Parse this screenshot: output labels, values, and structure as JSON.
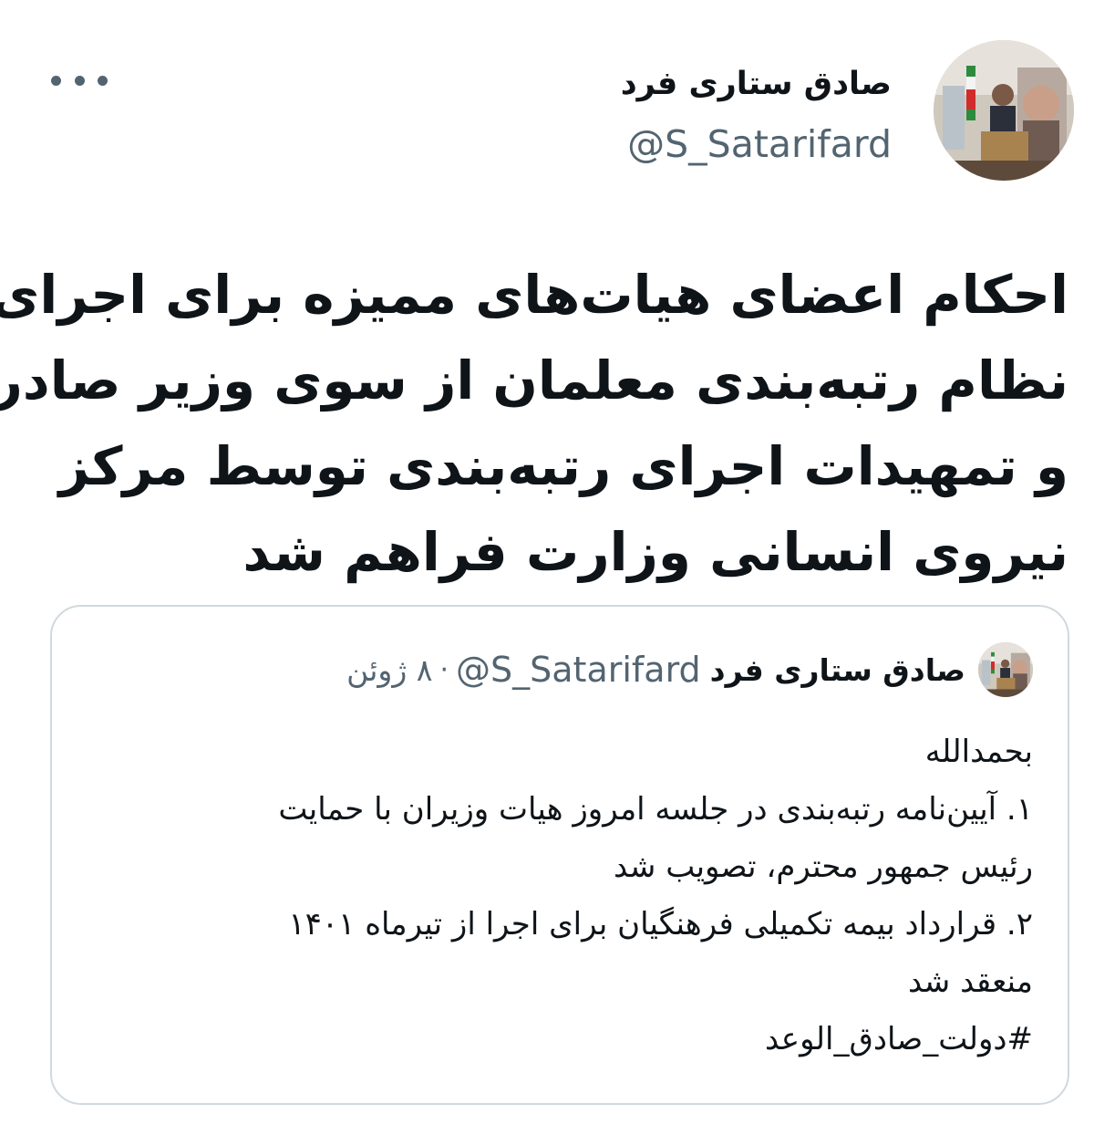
{
  "author": {
    "display_name": "صادق ستاری فرد",
    "handle": "@S_Satarifard",
    "avatar_icon": "profile-photo"
  },
  "more_icon": "more-options-icon",
  "tweet": {
    "text_lines": [
      "احکام اعضای هیات‌های ممیزه برای اجرای",
      "نظام رتبه‌بندی معلمان از سوی وزیر صادر",
      "و تمهیدات اجرای رتبه‌بندی توسط مرکز",
      "نیروی انسانی وزارت فراهم شد"
    ]
  },
  "quoted_tweet": {
    "display_name": "صادق ستاری فرد",
    "handle": "@S_Satarifard",
    "separator": "·",
    "date": "۸ ژوئن",
    "body_lines": [
      "بحمدالله",
      "۱. آیین‌نامه رتبه‌بندی در جلسه امروز هیات وزیران با حمایت",
      "رئیس جمهور محترم، تصویب شد",
      "۲. قرارداد بیمه تکمیلی فرهنگیان برای اجرا از تیرماه ۱۴۰۱",
      "منعقد شد",
      "#دولت_صادق_الوعد"
    ]
  },
  "colors": {
    "text_primary": "#0f1419",
    "text_secondary": "#536471",
    "border": "#cfd9de"
  }
}
